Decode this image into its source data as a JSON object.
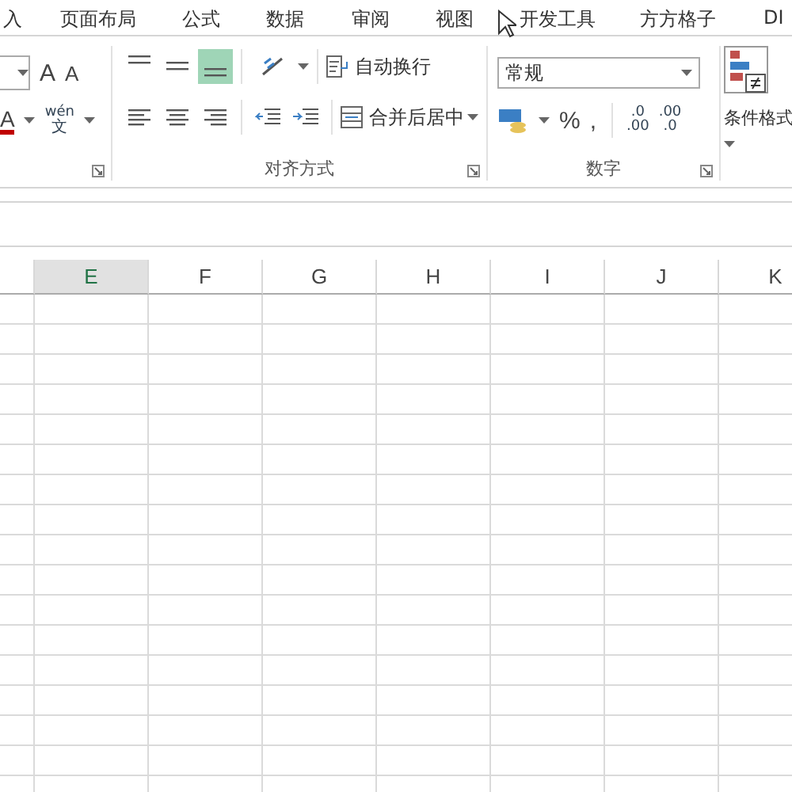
{
  "tabs": [
    {
      "label": "入",
      "selected": false
    },
    {
      "label": "页面布局",
      "selected": false
    },
    {
      "label": "公式",
      "selected": false
    },
    {
      "label": "数据",
      "selected": false
    },
    {
      "label": "审阅",
      "selected": false
    },
    {
      "label": "视图",
      "selected": false
    },
    {
      "label": "开发工具",
      "selected": false
    },
    {
      "label": "方方格子",
      "selected": false
    },
    {
      "label": "DI",
      "selected": false
    }
  ],
  "font_group": {
    "grow_font": "A",
    "shrink_font": "A",
    "font_color": "A",
    "phonetic_top": "wén",
    "phonetic_bottom": "文"
  },
  "alignment_group": {
    "label": "对齐方式",
    "vertical_align": [
      {
        "kind": "top",
        "selected": false
      },
      {
        "kind": "middle",
        "selected": false
      },
      {
        "kind": "bottom",
        "selected": true
      }
    ],
    "wrap_text": "自动换行",
    "merge_center": "合并后居中"
  },
  "number_group": {
    "label": "数字",
    "format": "常规",
    "percent": "%",
    "comma": ",",
    "increase_decimal": [
      ".0",
      ".00"
    ],
    "decrease_decimal": [
      ".00",
      ".0"
    ]
  },
  "styles_group": {
    "conditional_format": "条件格式"
  },
  "columns": [
    {
      "label": "E",
      "selected": true
    },
    {
      "label": "F",
      "selected": false
    },
    {
      "label": "G",
      "selected": false
    },
    {
      "label": "H",
      "selected": false
    },
    {
      "label": "I",
      "selected": false
    },
    {
      "label": "J",
      "selected": false
    },
    {
      "label": "K",
      "selected": false
    }
  ]
}
